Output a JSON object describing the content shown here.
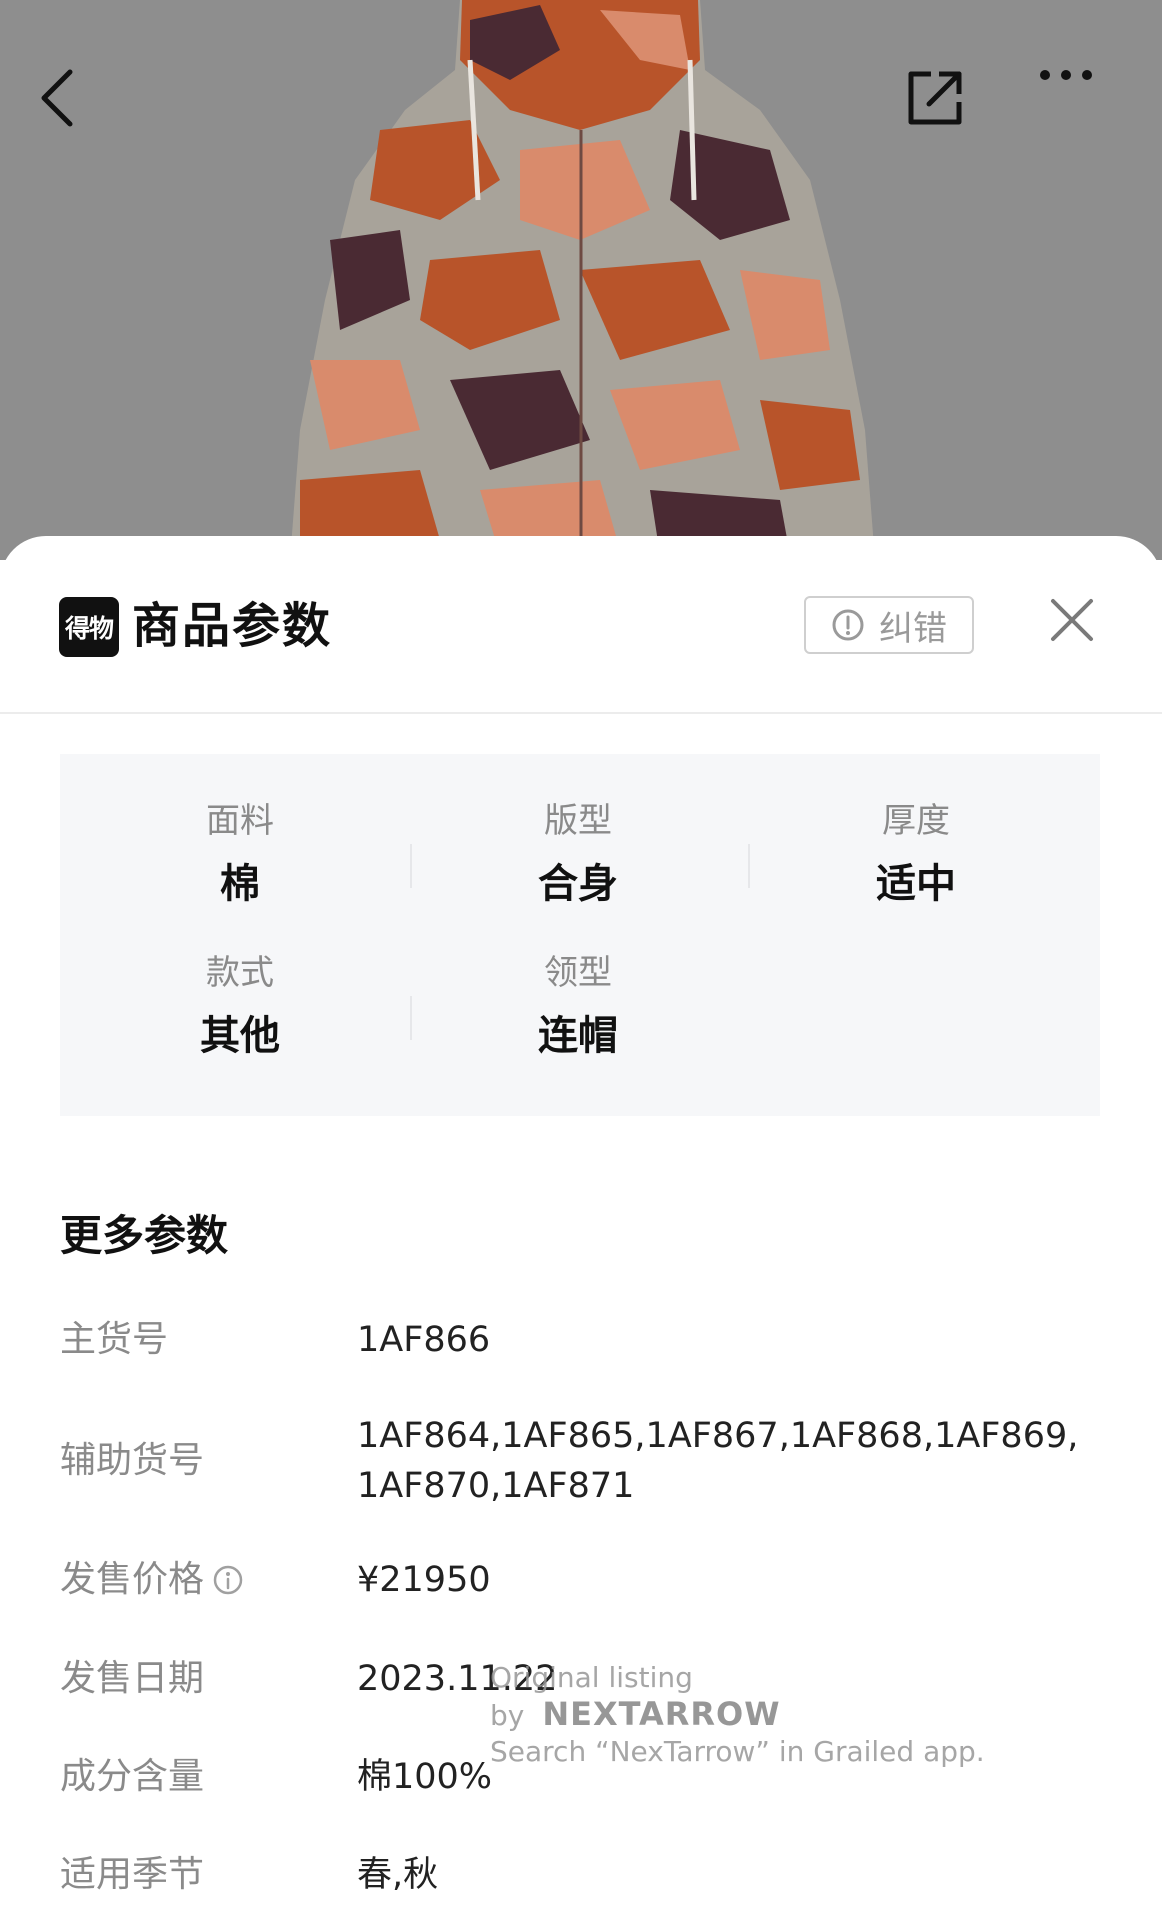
{
  "header": {
    "back_icon": "chevron-left-icon",
    "share_icon": "share-external-icon",
    "more_icon": "more-dots-icon"
  },
  "sheet": {
    "brand_logo": "得物",
    "title": "商品参数",
    "report_label": "纠错",
    "close_icon": "close-icon"
  },
  "key_params": [
    {
      "label": "面料",
      "value": "棉"
    },
    {
      "label": "版型",
      "value": "合身"
    },
    {
      "label": "厚度",
      "value": "适中"
    },
    {
      "label": "款式",
      "value": "其他"
    },
    {
      "label": "领型",
      "value": "连帽"
    }
  ],
  "more_params": {
    "title": "更多参数",
    "rows": [
      {
        "label": "主货号",
        "value": "1AF866"
      },
      {
        "label": "辅助货号",
        "value": "1AF864,1AF865,1AF867,1AF868,1AF869,\n1AF870,1AF871"
      },
      {
        "label": "发售价格",
        "value": "¥21950"
      },
      {
        "label": "发售日期",
        "value": "2023.11.22"
      },
      {
        "label": "成分含量",
        "value": "棉100%"
      },
      {
        "label": "适用季节",
        "value": "春,秋"
      }
    ]
  },
  "watermark": {
    "line1": "Original listing by",
    "brand": "NEXTARROW",
    "line2": "Search “NexTarrow” in Grailed app."
  },
  "colors": {
    "hero_bg": "#8e8e8e",
    "camo_orange": "#b8542a",
    "camo_salmon": "#d98b6c",
    "camo_plum": "#4a2a33",
    "camo_grey": "#a8a39a"
  }
}
